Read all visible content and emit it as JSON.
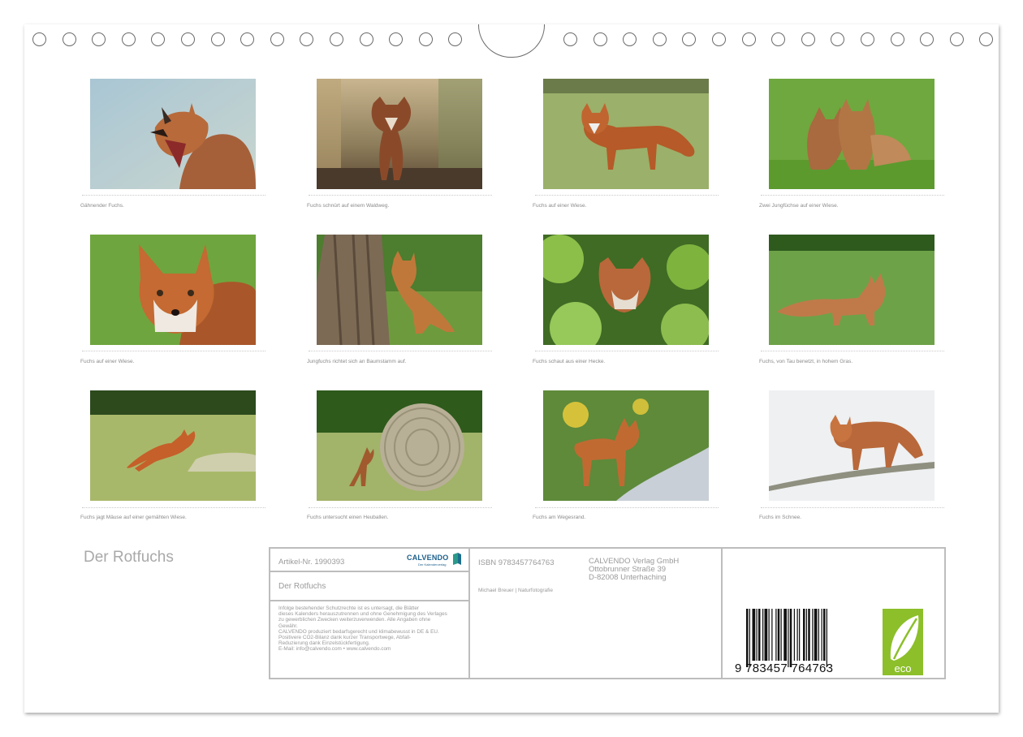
{
  "calendar": {
    "title": "Der Rotfuchs"
  },
  "photos": [
    {
      "caption": "Gähnender Fuchs."
    },
    {
      "caption": "Fuchs schnürt auf einem Waldweg."
    },
    {
      "caption": "Fuchs auf einer Wiese."
    },
    {
      "caption": "Zwei Jungfüchse auf einer Wiese."
    },
    {
      "caption": "Fuchs auf einer Wiese."
    },
    {
      "caption": "Jungfuchs richtet sich an Baumstamm auf."
    },
    {
      "caption": "Fuchs schaut aus einer Hecke."
    },
    {
      "caption": "Fuchs, von Tau benetzt, in hohem Gras."
    },
    {
      "caption": "Fuchs jagt Mäuse auf einer gemähten Wiese."
    },
    {
      "caption": "Fuchs untersucht einen Heuballen."
    },
    {
      "caption": "Fuchs am Wegesrand."
    },
    {
      "caption": "Fuchs im Schnee."
    }
  ],
  "info": {
    "article_no": "Artikel-Nr. 1990393",
    "title": "Der Rotfuchs",
    "isbn": "ISBN 9783457764763",
    "publisher": [
      "CALVENDO Verlag GmbH",
      "Ottobrunner Straße 39",
      "D-82008 Unterhaching"
    ],
    "author": "Michael Breuer | Naturfotografie",
    "legal": [
      "Infolge bestehender Schutzrechte ist es untersagt, die Blätter",
      "dieses Kalenders herauszutrennen und ohne Genehmigung des Verlages",
      "zu gewerblichen Zwecken weiterzuverwenden. Alle Angaben ohne",
      "Gewähr.",
      "CALVENDO produziert bedarfsgerecht und klimabewusst in DE & EU.",
      "Positivere CO2-Bilanz dank kurzer Transportwege, Abfall-",
      "Reduzierung dank Einzelstückfertigung.",
      "E-Mail: info@calvendo.com • www.calvendo.com"
    ],
    "logo_text": "CALVENDO",
    "logo_sub": "Der Kalenderverlag",
    "barcode_digits": "9 783457 764763",
    "eco_label": "eco"
  }
}
